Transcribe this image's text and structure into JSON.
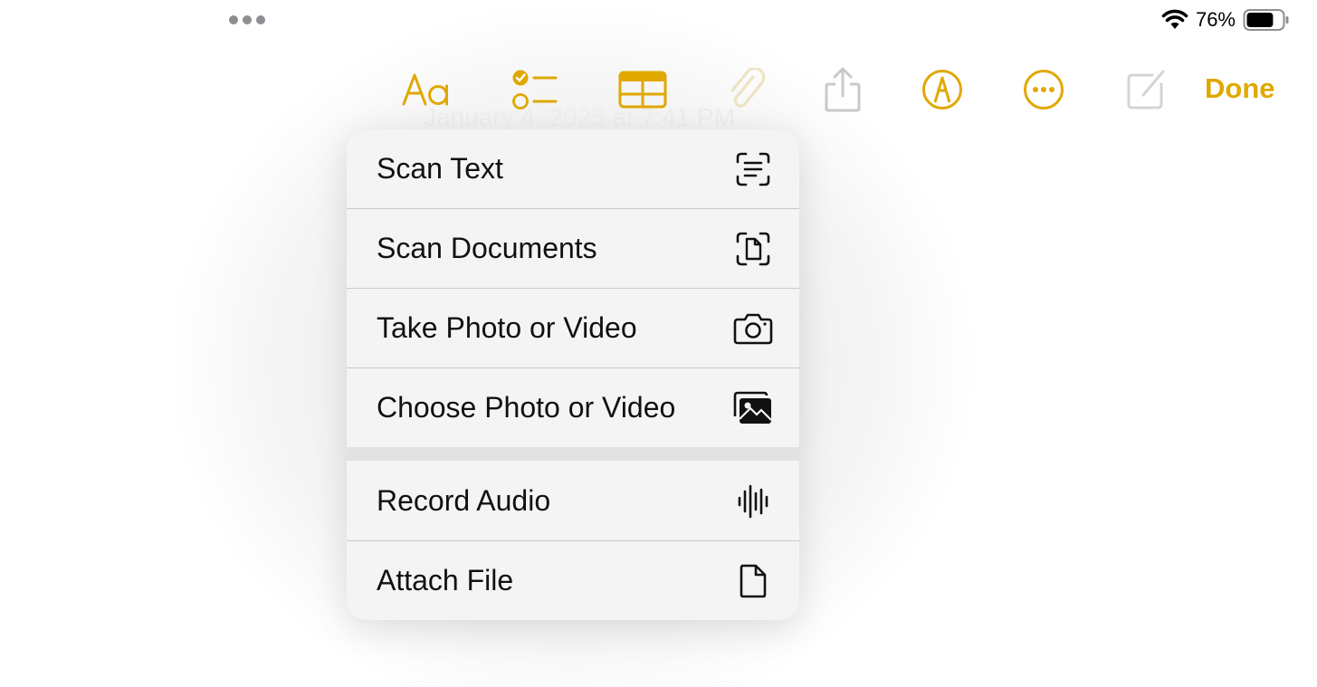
{
  "status_bar": {
    "battery_percent": "76%",
    "battery_level": 0.76,
    "icons": [
      "more-dots-icon",
      "wifi-icon",
      "battery-icon"
    ]
  },
  "toolbar": {
    "items": [
      "text-format-icon",
      "checklist-icon",
      "table-icon",
      "paperclip-icon",
      "share-icon",
      "markup-pen-icon",
      "more-circle-icon",
      "compose-icon"
    ],
    "done_label": "Done",
    "accent_color": "#e0a800",
    "disabled_color": "#c9c9c9"
  },
  "note": {
    "date_text": "January 4, 2025 at 7:41 PM"
  },
  "attach_menu": {
    "items": [
      {
        "label": "Scan Text",
        "icon": "scan-text-icon"
      },
      {
        "label": "Scan Documents",
        "icon": "scan-documents-icon"
      },
      {
        "label": "Take Photo or Video",
        "icon": "camera-icon"
      },
      {
        "label": "Choose Photo or Video",
        "icon": "photo-library-icon"
      },
      {
        "label": "Record Audio",
        "icon": "waveform-icon"
      },
      {
        "label": "Attach File",
        "icon": "document-icon"
      }
    ]
  }
}
